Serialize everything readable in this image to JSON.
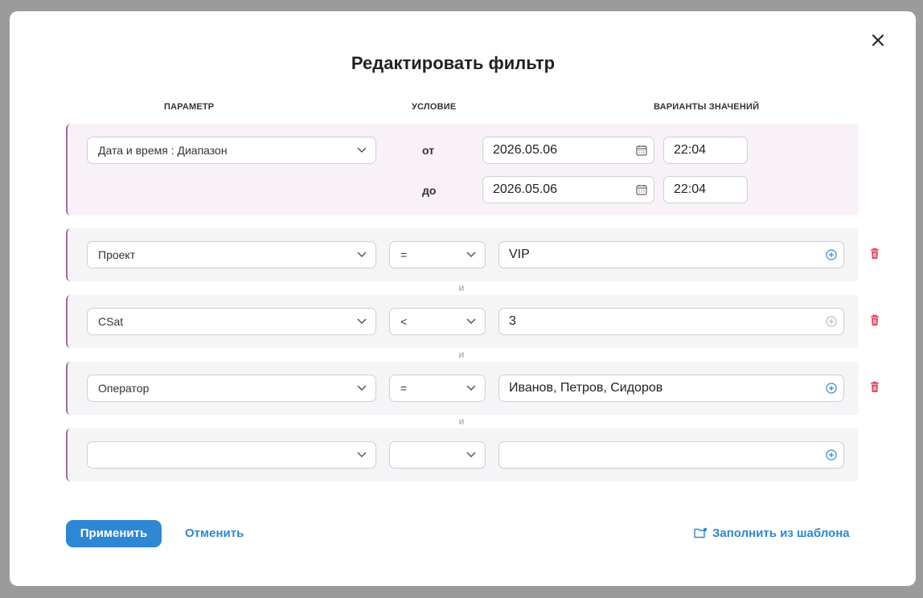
{
  "dialog": {
    "title": "Редактировать фильтр",
    "close_icon": "close-icon"
  },
  "columns": {
    "param": "ПАРАМЕТР",
    "condition": "УСЛОВИЕ",
    "values": "ВАРИАНТЫ ЗНАЧЕНИЙ"
  },
  "date_filter": {
    "param": "Дата и время : Диапазон",
    "from_label": "от",
    "to_label": "до",
    "from_date": "2026.05.06",
    "from_time": "22:04",
    "to_date": "2026.05.06",
    "to_time": "22:04"
  },
  "filters": [
    {
      "param": "Проект",
      "op": "=",
      "value": "VIP"
    },
    {
      "param": "CSat",
      "op": "<",
      "value": "3"
    },
    {
      "param": "Оператор",
      "op": "=",
      "value": "Иванов, Петров, Сидоров"
    },
    {
      "param": "",
      "op": "",
      "value": ""
    }
  ],
  "connector": "и",
  "footer": {
    "apply": "Применить",
    "cancel": "Отменить",
    "template": "Заполнить из шаблона"
  },
  "colors": {
    "accent": "#2d87d3",
    "row_border": "#a06a9a",
    "delete": "#e04a66"
  }
}
